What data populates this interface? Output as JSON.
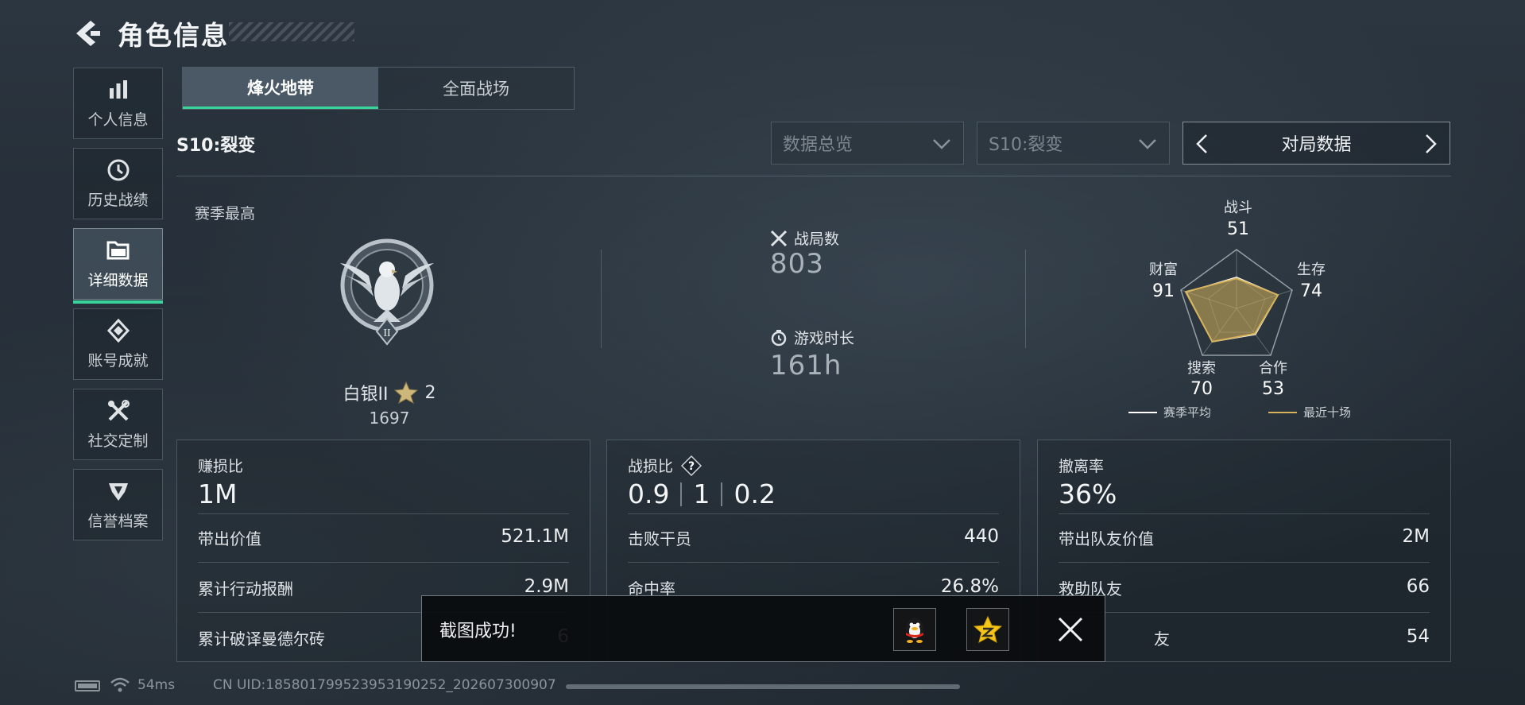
{
  "header": {
    "title": "角色信息"
  },
  "nav": {
    "items": [
      {
        "label": "个人信息",
        "icon": "bar-chart-icon"
      },
      {
        "label": "历史战绩",
        "icon": "clock-icon"
      },
      {
        "label": "详细数据",
        "icon": "folder-icon",
        "active": true
      },
      {
        "label": "账号成就",
        "icon": "medal-icon"
      },
      {
        "label": "社交定制",
        "icon": "tools-icon"
      },
      {
        "label": "信誉档案",
        "icon": "shield-badge-icon"
      }
    ]
  },
  "tabs": [
    {
      "label": "烽火地带",
      "active": true
    },
    {
      "label": "全面战场",
      "active": false
    }
  ],
  "season": {
    "label": "S10:裂变"
  },
  "filters": {
    "overview": "数据总览",
    "season": "S10:裂变",
    "switcher": "对局数据"
  },
  "season_best": {
    "label": "赛季最高",
    "rank": "白银II",
    "stars": "2",
    "score": "1697"
  },
  "center_stats": {
    "matches_label": "战局数",
    "matches_value": "803",
    "playtime_label": "游戏时长",
    "playtime_value": "161h"
  },
  "radar": {
    "axes": [
      {
        "label": "战斗",
        "value": 51
      },
      {
        "label": "生存",
        "value": 74
      },
      {
        "label": "合作",
        "value": 53
      },
      {
        "label": "搜索",
        "value": 70
      },
      {
        "label": "财富",
        "value": 91
      }
    ],
    "legend_season": "赛季平均",
    "legend_recent": "最近十场",
    "colors": {
      "season": "#ffffff",
      "recent": "#d6b25a"
    }
  },
  "cards": {
    "profit": {
      "title": "赚损比",
      "big": "1M",
      "rows": [
        {
          "label": "带出价值",
          "value": "521.1M"
        },
        {
          "label": "累计行动报酬",
          "value": "2.9M"
        },
        {
          "label": "累计破译曼德尔砖",
          "value": "6"
        }
      ]
    },
    "kd": {
      "title": "战损比",
      "big": [
        "0.9",
        "1",
        "0.2"
      ],
      "rows": [
        {
          "label": "击败干员",
          "value": "440"
        },
        {
          "label": "命中率",
          "value": "26.8%"
        }
      ]
    },
    "extract": {
      "title": "撤离率",
      "big": "36%",
      "rows": [
        {
          "label": "带出队友价值",
          "value": "2M"
        },
        {
          "label": "救助队友",
          "value": "66"
        },
        {
          "label": "友",
          "value": "54"
        }
      ]
    }
  },
  "toast": {
    "text": "截图成功!"
  },
  "footer": {
    "ping": "54ms",
    "uid": "CN UID:185801799523953190252_202607300907"
  },
  "accent": "#38d49a"
}
